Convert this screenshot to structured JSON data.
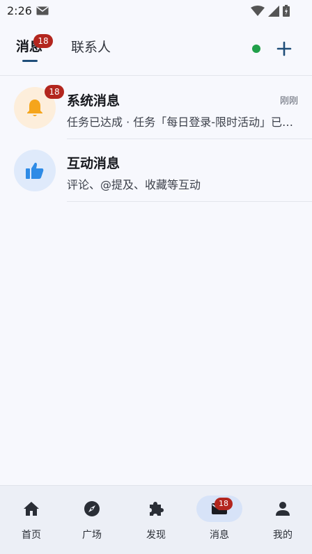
{
  "status_bar": {
    "time": "2:26",
    "icons": [
      "mail-icon",
      "wifi-icon",
      "signal-icon",
      "battery-icon"
    ]
  },
  "header": {
    "tabs": [
      {
        "label": "消息",
        "badge": "18"
      },
      {
        "label": "联系人"
      }
    ],
    "icons": [
      "online-status-icon",
      "add-icon"
    ]
  },
  "conversations": [
    {
      "title": "系统消息",
      "time": "刚刚",
      "preview": "任务已达成 · 任务「每日登录-限时活动」已完成",
      "badge": "18",
      "icon": "bell-icon"
    },
    {
      "title": "互动消息",
      "preview": "评论、@提及、收藏等互动",
      "icon": "thumbs-up-icon"
    }
  ],
  "bottom_nav": [
    {
      "label": "首页",
      "icon": "home-icon"
    },
    {
      "label": "广场",
      "icon": "compass-icon"
    },
    {
      "label": "发现",
      "icon": "puzzle-icon"
    },
    {
      "label": "消息",
      "icon": "mail-icon",
      "badge": "18",
      "active": true
    },
    {
      "label": "我的",
      "icon": "person-icon"
    }
  ],
  "colors": {
    "accent": "#1f4e79",
    "badge": "#b3261e",
    "online": "#21a04a",
    "bell": "#f5a51c",
    "thumb": "#2e8be6"
  }
}
